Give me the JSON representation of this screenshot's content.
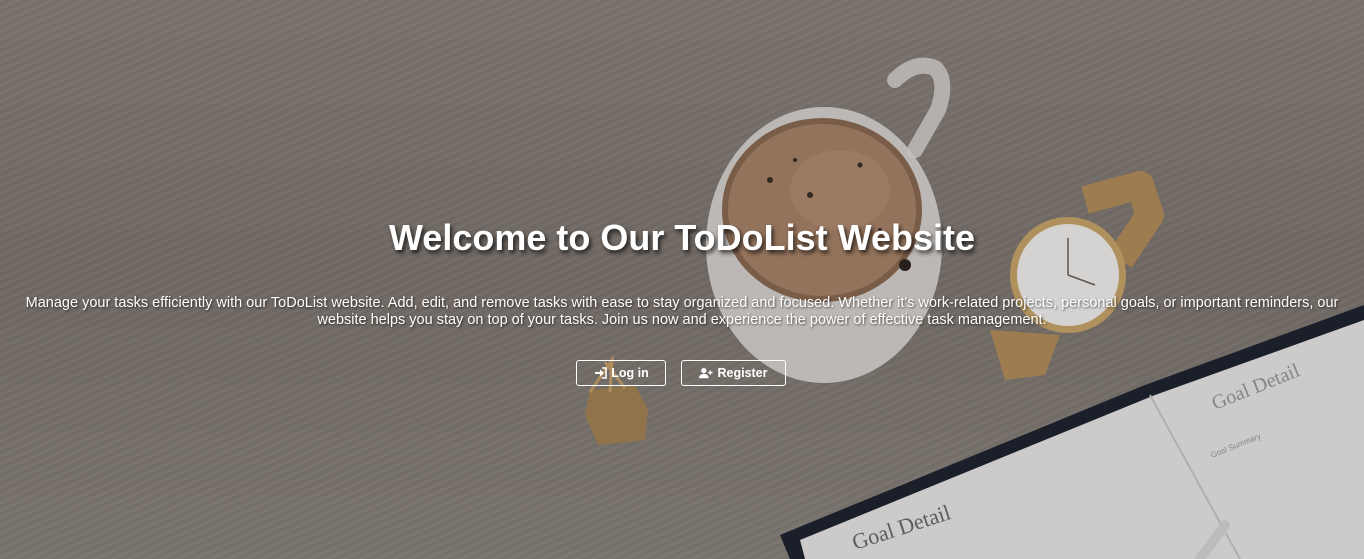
{
  "hero": {
    "title": "Welcome to Our ToDoList Website",
    "description": "Manage your tasks efficiently with our ToDoList website. Add, edit, and remove tasks with ease to stay organized and focused. Whether it's work-related projects, personal goals, or important reminders, our website helps you stay on top of your tasks. Join us now and experience the power of effective task management.",
    "background_image": {
      "notebook_heading_1": "Goal Detail",
      "notebook_heading_2": "Goal Detail",
      "notebook_subheading": "Goal Summary"
    }
  },
  "actions": {
    "login_label": "Log in",
    "login_icon": "sign-in-icon",
    "register_label": "Register",
    "register_icon": "user-plus-icon"
  },
  "colors": {
    "text": "#ffffff",
    "button_border": "#ffffff"
  }
}
